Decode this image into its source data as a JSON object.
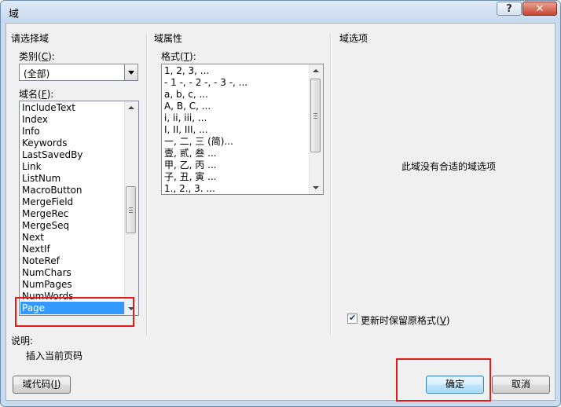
{
  "window": {
    "title": "域",
    "help_label": "?",
    "close_label": "✕"
  },
  "select_field": {
    "group_title": "请选择域",
    "category_label_prefix": "类别(",
    "category_label_key": "C",
    "category_label_suffix": "):",
    "category_value": "(全部)",
    "field_names_label_prefix": "域名(",
    "field_names_label_key": "F",
    "field_names_label_suffix": "):",
    "field_names": [
      "IncludeText",
      "Index",
      "Info",
      "Keywords",
      "LastSavedBy",
      "Link",
      "ListNum",
      "MacroButton",
      "MergeField",
      "MergeRec",
      "MergeSeq",
      "Next",
      "NextIf",
      "NoteRef",
      "NumChars",
      "NumPages",
      "NumWords",
      "Page"
    ],
    "selected": "Page"
  },
  "field_properties": {
    "group_title": "域属性",
    "format_label_prefix": "格式(",
    "format_label_key": "T",
    "format_label_suffix": "):",
    "formats": [
      "1, 2, 3, ...",
      "- 1 -, - 2 -, - 3 -, ...",
      "a, b, c, ...",
      "A, B, C, ...",
      "i, ii, iii, ...",
      "I, II, III, ...",
      "一, 二, 三 (简)...",
      "壹, 贰, 叁 ...",
      "甲, 乙, 丙 ...",
      "子, 丑, 寅 ...",
      "1., 2., 3. ..."
    ]
  },
  "field_options": {
    "group_title": "域选项",
    "no_options_text": "此域没有合适的域选项",
    "preserve_label_prefix": "更新时保留原格式(",
    "preserve_label_key": "V",
    "preserve_label_suffix": ")",
    "preserve_checked": true
  },
  "description": {
    "label": "说明:",
    "text": "插入当前页码"
  },
  "buttons": {
    "field_codes_prefix": "域代码(",
    "field_codes_key": "I",
    "field_codes_suffix": ")",
    "ok": "确定",
    "cancel": "取消"
  },
  "colors": {
    "selection": "#3399ff",
    "highlight_box": "#e11b1b"
  }
}
